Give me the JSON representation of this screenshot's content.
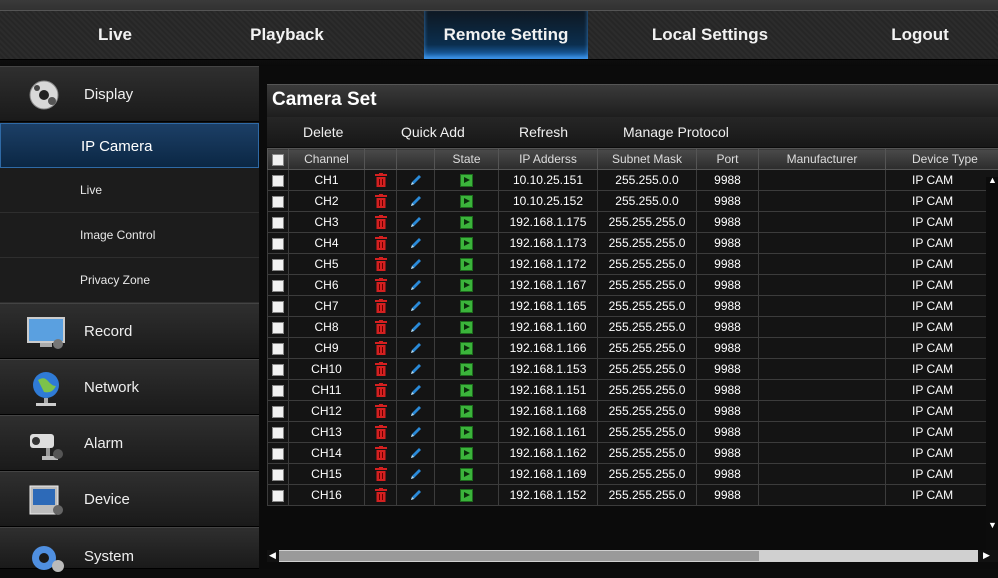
{
  "nav": {
    "live": "Live",
    "playback": "Playback",
    "remote_setting": "Remote Setting",
    "local_settings": "Local Settings",
    "logout": "Logout"
  },
  "sidebar": {
    "display": "Display",
    "ip_camera": "IP Camera",
    "live": "Live",
    "image_control": "Image Control",
    "privacy_zone": "Privacy Zone",
    "record": "Record",
    "network": "Network",
    "alarm": "Alarm",
    "device": "Device",
    "system": "System"
  },
  "panel": {
    "title": "Camera Set",
    "toolbar": {
      "delete": "Delete",
      "quick_add": "Quick Add",
      "refresh": "Refresh",
      "manage_protocol": "Manage Protocol"
    }
  },
  "table": {
    "headers": {
      "channel": "Channel",
      "state": "State",
      "ip": "IP Adderss",
      "subnet": "Subnet Mask",
      "port": "Port",
      "manufacturer": "Manufacturer",
      "device_type": "Device Type"
    },
    "rows": [
      {
        "channel": "CH1",
        "ip": "10.10.25.151",
        "subnet": "255.255.0.0",
        "port": "9988",
        "manufacturer": "",
        "device_type": "IP CAM"
      },
      {
        "channel": "CH2",
        "ip": "10.10.25.152",
        "subnet": "255.255.0.0",
        "port": "9988",
        "manufacturer": "",
        "device_type": "IP CAM"
      },
      {
        "channel": "CH3",
        "ip": "192.168.1.175",
        "subnet": "255.255.255.0",
        "port": "9988",
        "manufacturer": "",
        "device_type": "IP CAM"
      },
      {
        "channel": "CH4",
        "ip": "192.168.1.173",
        "subnet": "255.255.255.0",
        "port": "9988",
        "manufacturer": "",
        "device_type": "IP CAM"
      },
      {
        "channel": "CH5",
        "ip": "192.168.1.172",
        "subnet": "255.255.255.0",
        "port": "9988",
        "manufacturer": "",
        "device_type": "IP CAM"
      },
      {
        "channel": "CH6",
        "ip": "192.168.1.167",
        "subnet": "255.255.255.0",
        "port": "9988",
        "manufacturer": "",
        "device_type": "IP CAM"
      },
      {
        "channel": "CH7",
        "ip": "192.168.1.165",
        "subnet": "255.255.255.0",
        "port": "9988",
        "manufacturer": "",
        "device_type": "IP CAM"
      },
      {
        "channel": "CH8",
        "ip": "192.168.1.160",
        "subnet": "255.255.255.0",
        "port": "9988",
        "manufacturer": "",
        "device_type": "IP CAM"
      },
      {
        "channel": "CH9",
        "ip": "192.168.1.166",
        "subnet": "255.255.255.0",
        "port": "9988",
        "manufacturer": "",
        "device_type": "IP CAM"
      },
      {
        "channel": "CH10",
        "ip": "192.168.1.153",
        "subnet": "255.255.255.0",
        "port": "9988",
        "manufacturer": "",
        "device_type": "IP CAM"
      },
      {
        "channel": "CH11",
        "ip": "192.168.1.151",
        "subnet": "255.255.255.0",
        "port": "9988",
        "manufacturer": "",
        "device_type": "IP CAM"
      },
      {
        "channel": "CH12",
        "ip": "192.168.1.168",
        "subnet": "255.255.255.0",
        "port": "9988",
        "manufacturer": "",
        "device_type": "IP CAM"
      },
      {
        "channel": "CH13",
        "ip": "192.168.1.161",
        "subnet": "255.255.255.0",
        "port": "9988",
        "manufacturer": "",
        "device_type": "IP CAM"
      },
      {
        "channel": "CH14",
        "ip": "192.168.1.162",
        "subnet": "255.255.255.0",
        "port": "9988",
        "manufacturer": "",
        "device_type": "IP CAM"
      },
      {
        "channel": "CH15",
        "ip": "192.168.1.169",
        "subnet": "255.255.255.0",
        "port": "9988",
        "manufacturer": "",
        "device_type": "IP CAM"
      },
      {
        "channel": "CH16",
        "ip": "192.168.1.152",
        "subnet": "255.255.255.0",
        "port": "9988",
        "manufacturer": "",
        "device_type": "IP CAM"
      }
    ]
  },
  "colors": {
    "accent": "#1e6fc1",
    "delete_icon": "#d42020",
    "edit_icon": "#2a8ad8",
    "state_icon": "#3bb43b"
  },
  "icons": {
    "delete": "trash-icon",
    "edit": "pencil-icon",
    "state": "play-icon"
  }
}
